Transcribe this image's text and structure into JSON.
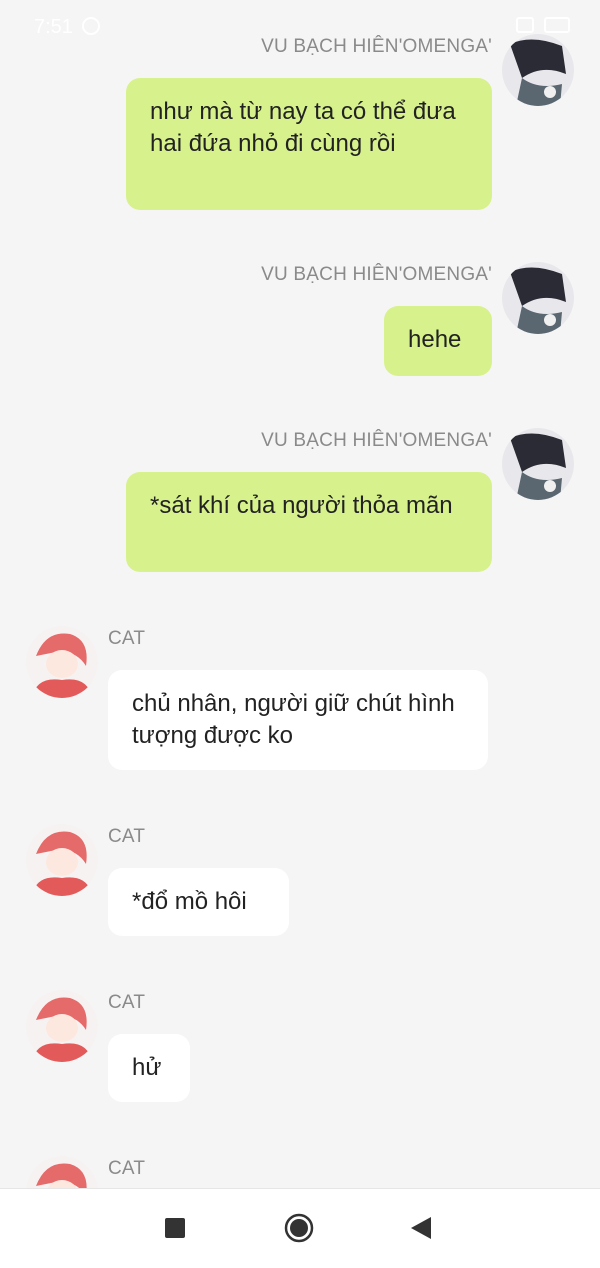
{
  "status_bar": {
    "time": "7:51"
  },
  "messages": [
    {
      "side": "right",
      "sender": "VU BẠCH HIÊN'OMENGA'",
      "text": "như mà từ nay ta có thể đưa hai đứa nhỏ đi cùng rồi"
    },
    {
      "side": "right",
      "sender": "VU BẠCH HIÊN'OMENGA'",
      "text": "hehe"
    },
    {
      "side": "right",
      "sender": "VU BẠCH HIÊN'OMENGA'",
      "text": "*sát khí của người thỏa mãn"
    },
    {
      "side": "left",
      "sender": "CAT",
      "text": "chủ nhân, người giữ chút hình tượng được ko"
    },
    {
      "side": "left",
      "sender": "CAT",
      "text": "*đổ mồ hôi"
    },
    {
      "side": "left",
      "sender": "CAT",
      "text": "hử"
    },
    {
      "side": "left",
      "sender": "CAT",
      "text": ""
    }
  ],
  "colors": {
    "right_bubble": "#d7f28c",
    "left_bubble": "#ffffff",
    "background": "#f5f5f5"
  },
  "navbar": {
    "icons": [
      "stop-square-icon",
      "home-circle-icon",
      "back-triangle-icon"
    ]
  }
}
